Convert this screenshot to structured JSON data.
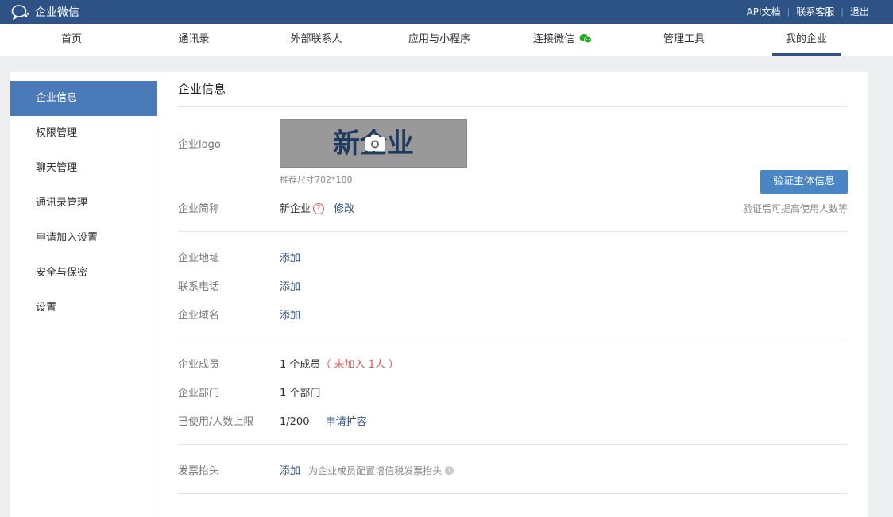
{
  "topbar": {
    "brand": "企业微信",
    "links": [
      "API文档",
      "联系客服",
      "退出"
    ],
    "bg_color": "#2d5386"
  },
  "nav": {
    "items": [
      "首页",
      "通讯录",
      "外部联系人",
      "应用与小程序",
      "连接微信",
      "管理工具",
      "我的企业"
    ],
    "active": "我的企业"
  },
  "sidebar": {
    "items": [
      "企业信息",
      "权限管理",
      "聊天管理",
      "通讯录管理",
      "申请加入设置",
      "安全与保密",
      "设置"
    ],
    "active": "企业信息"
  },
  "main": {
    "title": "企业信息",
    "logo": {
      "label": "企业logo",
      "text": "新企业",
      "hint": "推荐尺寸702*180"
    },
    "verify": {
      "button": "验证主体信息",
      "note": "验证后可提高使用人数等"
    },
    "short_name": {
      "label": "企业简称",
      "value": "新企业",
      "help": "?",
      "edit": "修改"
    },
    "address": {
      "label": "企业地址",
      "action": "添加"
    },
    "phone": {
      "label": "联系电话",
      "action": "添加"
    },
    "domain": {
      "label": "企业域名",
      "action": "添加"
    },
    "members": {
      "label": "企业成员",
      "value": "1 个成员",
      "pending": "（ 未加入 1人 ）"
    },
    "departments": {
      "label": "企业部门",
      "value": "1 个部门"
    },
    "usage": {
      "label": "已使用/人数上限",
      "value": "1/200",
      "action": "申请扩容"
    },
    "invoice": {
      "label": "发票抬头",
      "action": "添加",
      "note": "为企业成员配置增值税发票抬头"
    }
  }
}
